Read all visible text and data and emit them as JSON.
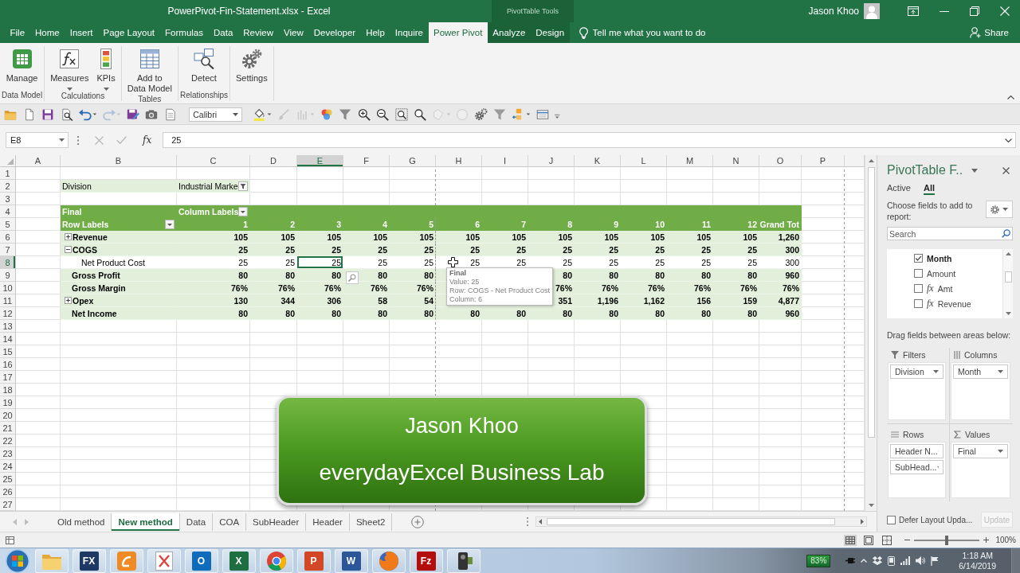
{
  "title_bar": {
    "title": "PowerPivot-Fin-Statement.xlsx - Excel",
    "context_label": "PivotTable Tools",
    "user_name": "Jason Khoo"
  },
  "ribbon_tabs": [
    {
      "label": "File",
      "selected": false,
      "contextual": false
    },
    {
      "label": "Home",
      "selected": false,
      "contextual": false
    },
    {
      "label": "Insert",
      "selected": false,
      "contextual": false
    },
    {
      "label": "Page Layout",
      "selected": false,
      "contextual": false
    },
    {
      "label": "Formulas",
      "selected": false,
      "contextual": false
    },
    {
      "label": "Data",
      "selected": false,
      "contextual": false
    },
    {
      "label": "Review",
      "selected": false,
      "contextual": false
    },
    {
      "label": "View",
      "selected": false,
      "contextual": false
    },
    {
      "label": "Developer",
      "selected": false,
      "contextual": false
    },
    {
      "label": "Help",
      "selected": false,
      "contextual": false
    },
    {
      "label": "Inquire",
      "selected": false,
      "contextual": false
    },
    {
      "label": "Power Pivot",
      "selected": true,
      "contextual": false
    },
    {
      "label": "Analyze",
      "selected": false,
      "contextual": true
    },
    {
      "label": "Design",
      "selected": false,
      "contextual": true
    }
  ],
  "tell_me": {
    "placeholder": "Tell me what you want to do"
  },
  "share": {
    "label": "Share"
  },
  "ribbon_groups": [
    {
      "label": "Data Model",
      "commands": [
        {
          "label": "Manage",
          "menu": false
        }
      ]
    },
    {
      "label": "Calculations",
      "commands": [
        {
          "label": "Measures",
          "menu": true
        },
        {
          "label": "KPIs",
          "menu": true
        }
      ]
    },
    {
      "label": "Tables",
      "commands": [
        {
          "label": "Add to\nData Model",
          "menu": false
        }
      ]
    },
    {
      "label": "Relationships",
      "commands": [
        {
          "label": "Detect",
          "menu": false
        }
      ]
    },
    {
      "commands": [
        {
          "label": "Settings",
          "menu": false
        }
      ]
    }
  ],
  "quick_access": [
    {
      "kind": "tool",
      "disabled": false
    },
    {
      "kind": "tool",
      "disabled": false
    },
    {
      "kind": "tool",
      "disabled": false
    },
    {
      "kind": "tool",
      "disabled": false
    },
    {
      "kind": "tool",
      "disabled": false
    },
    {
      "kind": "tool",
      "disabled": true
    },
    {
      "kind": "tool",
      "disabled": false
    },
    {
      "kind": "tool",
      "disabled": false
    },
    {
      "kind": "tool",
      "disabled": false
    },
    {
      "kind": "font",
      "value": "Calibri"
    },
    {
      "kind": "tool",
      "disabled": false
    },
    {
      "kind": "tool",
      "disabled": true
    },
    {
      "kind": "tool",
      "disabled": true
    },
    {
      "kind": "tool",
      "disabled": false
    },
    {
      "kind": "tool",
      "disabled": false
    },
    {
      "kind": "tool",
      "disabled": false
    },
    {
      "kind": "tool",
      "disabled": false
    },
    {
      "kind": "tool",
      "disabled": false
    },
    {
      "kind": "tool",
      "disabled": false
    },
    {
      "kind": "tool",
      "disabled": true
    },
    {
      "kind": "tool",
      "disabled": true
    },
    {
      "kind": "tool",
      "disabled": false
    },
    {
      "kind": "tool",
      "disabled": false
    },
    {
      "kind": "tool",
      "disabled": false
    },
    {
      "kind": "tool",
      "disabled": false
    },
    {
      "kind": "tool",
      "disabled": false
    }
  ],
  "formula_bar": {
    "name_box": "E8",
    "function_label": "fx",
    "formula": "25",
    "editing": false
  },
  "sheet": {
    "columns": [
      {
        "label": "A",
        "selected": false
      },
      {
        "label": "B",
        "selected": false
      },
      {
        "label": "C",
        "selected": false
      },
      {
        "label": "D",
        "selected": false
      },
      {
        "label": "E",
        "selected": true
      },
      {
        "label": "F",
        "selected": false
      },
      {
        "label": "G",
        "selected": false
      },
      {
        "label": "H",
        "selected": false
      },
      {
        "label": "I",
        "selected": false
      },
      {
        "label": "J",
        "selected": false
      },
      {
        "label": "K",
        "selected": false
      },
      {
        "label": "L",
        "selected": false
      },
      {
        "label": "M",
        "selected": false
      },
      {
        "label": "N",
        "selected": false
      },
      {
        "label": "O",
        "selected": false
      },
      {
        "label": "P",
        "selected": false
      }
    ],
    "rows": [
      {
        "label": "1",
        "selected": false
      },
      {
        "label": "2",
        "selected": false
      },
      {
        "label": "3",
        "selected": false
      },
      {
        "label": "4",
        "selected": false
      },
      {
        "label": "5",
        "selected": false
      },
      {
        "label": "6",
        "selected": false
      },
      {
        "label": "7",
        "selected": false
      },
      {
        "label": "8",
        "selected": true
      },
      {
        "label": "9",
        "selected": false
      },
      {
        "label": "10",
        "selected": false
      },
      {
        "label": "11",
        "selected": false
      },
      {
        "label": "12",
        "selected": false
      },
      {
        "label": "13",
        "selected": false
      },
      {
        "label": "14",
        "selected": false
      },
      {
        "label": "15",
        "selected": false
      },
      {
        "label": "16",
        "selected": false
      },
      {
        "label": "17",
        "selected": false
      },
      {
        "label": "18",
        "selected": false
      },
      {
        "label": "19",
        "selected": false
      },
      {
        "label": "20",
        "selected": false
      },
      {
        "label": "21",
        "selected": false
      },
      {
        "label": "22",
        "selected": false
      },
      {
        "label": "23",
        "selected": false
      },
      {
        "label": "24",
        "selected": false
      },
      {
        "label": "25",
        "selected": false
      },
      {
        "label": "26",
        "selected": false
      },
      {
        "label": "27",
        "selected": false
      }
    ]
  },
  "pivot": {
    "filter_field": "Division",
    "filter_value": "Industrial Marke",
    "value_field": "Final",
    "column_labels": "Column Labels",
    "row_labels": "Row Labels",
    "column_headers": [
      "1",
      "2",
      "3",
      "4",
      "5",
      "6",
      "7",
      "8",
      "9",
      "10",
      "11",
      "12",
      "Grand Tot"
    ],
    "rows": [
      {
        "label": "Revenue",
        "kind": "group",
        "expanded": false,
        "values": [
          "105",
          "105",
          "105",
          "105",
          "105",
          "105",
          "105",
          "105",
          "105",
          "105",
          "105",
          "105",
          "1,260"
        ]
      },
      {
        "label": "COGS",
        "kind": "group",
        "expanded": true,
        "values": [
          "25",
          "25",
          "25",
          "25",
          "25",
          "25",
          "25",
          "25",
          "25",
          "25",
          "25",
          "25",
          "300"
        ],
        "children": [
          {
            "label": "Net Product Cost",
            "kind": "line",
            "values": [
              "25",
              "25",
              "25",
              "25",
              "25",
              "25",
              "25",
              "25",
              "25",
              "25",
              "25",
              "25",
              "300"
            ]
          }
        ]
      },
      {
        "label": "Gross Profit",
        "kind": "line",
        "values": [
          "80",
          "80",
          "80",
          "80",
          "80"
        ],
        "trailing_values": [
          "80",
          "80",
          "80",
          "80",
          "80",
          "960"
        ]
      },
      {
        "label": "Gross Margin",
        "kind": "line",
        "values": [
          "76%",
          "76%",
          "76%",
          "76%",
          "76%"
        ],
        "trailing_values": [
          "76%",
          "76%",
          "76%",
          "76%",
          "76%",
          "76%"
        ]
      },
      {
        "label": "Opex",
        "kind": "group",
        "expanded": false,
        "values": [
          "130",
          "344",
          "306",
          "58",
          "54"
        ],
        "trailing_values": [
          "351",
          "1,196",
          "1,162",
          "156",
          "159",
          "4,877"
        ]
      },
      {
        "label": "Net Income",
        "kind": "line",
        "values": [
          "80",
          "80",
          "80",
          "80",
          "80",
          "80",
          "80",
          "80",
          "80",
          "80",
          "80",
          "80",
          "960"
        ]
      }
    ]
  },
  "tooltip": {
    "title": "Final",
    "lines": [
      "Value: 25",
      "Row: COGS - Net Product Cost",
      "Column: 6"
    ]
  },
  "banner": {
    "title": "Jason Khoo",
    "subtitle": "everydayExcel Business Lab"
  },
  "sheet_tabs": [
    {
      "label": "Old method",
      "selected": false
    },
    {
      "label": "New method",
      "selected": true
    },
    {
      "label": "Data",
      "selected": false
    },
    {
      "label": "COA",
      "selected": false
    },
    {
      "label": "SubHeader",
      "selected": false
    },
    {
      "label": "Header",
      "selected": false
    },
    {
      "label": "Sheet2",
      "selected": false
    }
  ],
  "field_pane": {
    "title": "PivotTable F..",
    "tabs": [
      {
        "label": "Active",
        "selected": false
      },
      {
        "label": "All",
        "selected": true
      }
    ],
    "instruction": "Choose fields to add to report:",
    "search": {
      "placeholder": "Search"
    },
    "fields": [
      {
        "label": "Month",
        "checked": true
      },
      {
        "label": "Amount",
        "checked": false
      },
      {
        "label": "Amt",
        "checked": false,
        "symbol": "fx"
      },
      {
        "label": "Revenue",
        "checked": false,
        "symbol": "fx"
      }
    ],
    "areas_hint": "Drag fields between areas below:",
    "areas": [
      {
        "label": "Filters",
        "fields": [
          "Division"
        ]
      },
      {
        "label": "Columns",
        "fields": [
          "Month"
        ]
      },
      {
        "label": "Rows",
        "fields": [
          "Header N...",
          "SubHead..."
        ]
      },
      {
        "label": "Values",
        "fields": [
          "Final"
        ]
      }
    ],
    "defer": {
      "label": "Defer Layout Upda...",
      "checked": false
    },
    "update": {
      "label": "Update",
      "disabled": true
    }
  },
  "status_bar": {
    "views": [
      {
        "selected": true
      },
      {
        "selected": false
      },
      {
        "selected": false
      }
    ],
    "zoom": {
      "level": 0.5,
      "label": "100%"
    }
  },
  "taskbar": {
    "apps": [
      {
        "running": true
      },
      {
        "running": true,
        "glyph": "FX"
      },
      {
        "running": true
      },
      {
        "running": true
      },
      {
        "running": true,
        "glyph": "O"
      },
      {
        "running": true,
        "glyph": "X"
      },
      {
        "running": true
      },
      {
        "running": true,
        "glyph": "P"
      },
      {
        "running": true,
        "glyph": "W"
      },
      {
        "running": true
      },
      {
        "running": true,
        "glyph": "Fz"
      },
      {
        "running": true
      }
    ],
    "battery": "83%",
    "time": "1:18 AM",
    "date": "6/14/2019"
  }
}
